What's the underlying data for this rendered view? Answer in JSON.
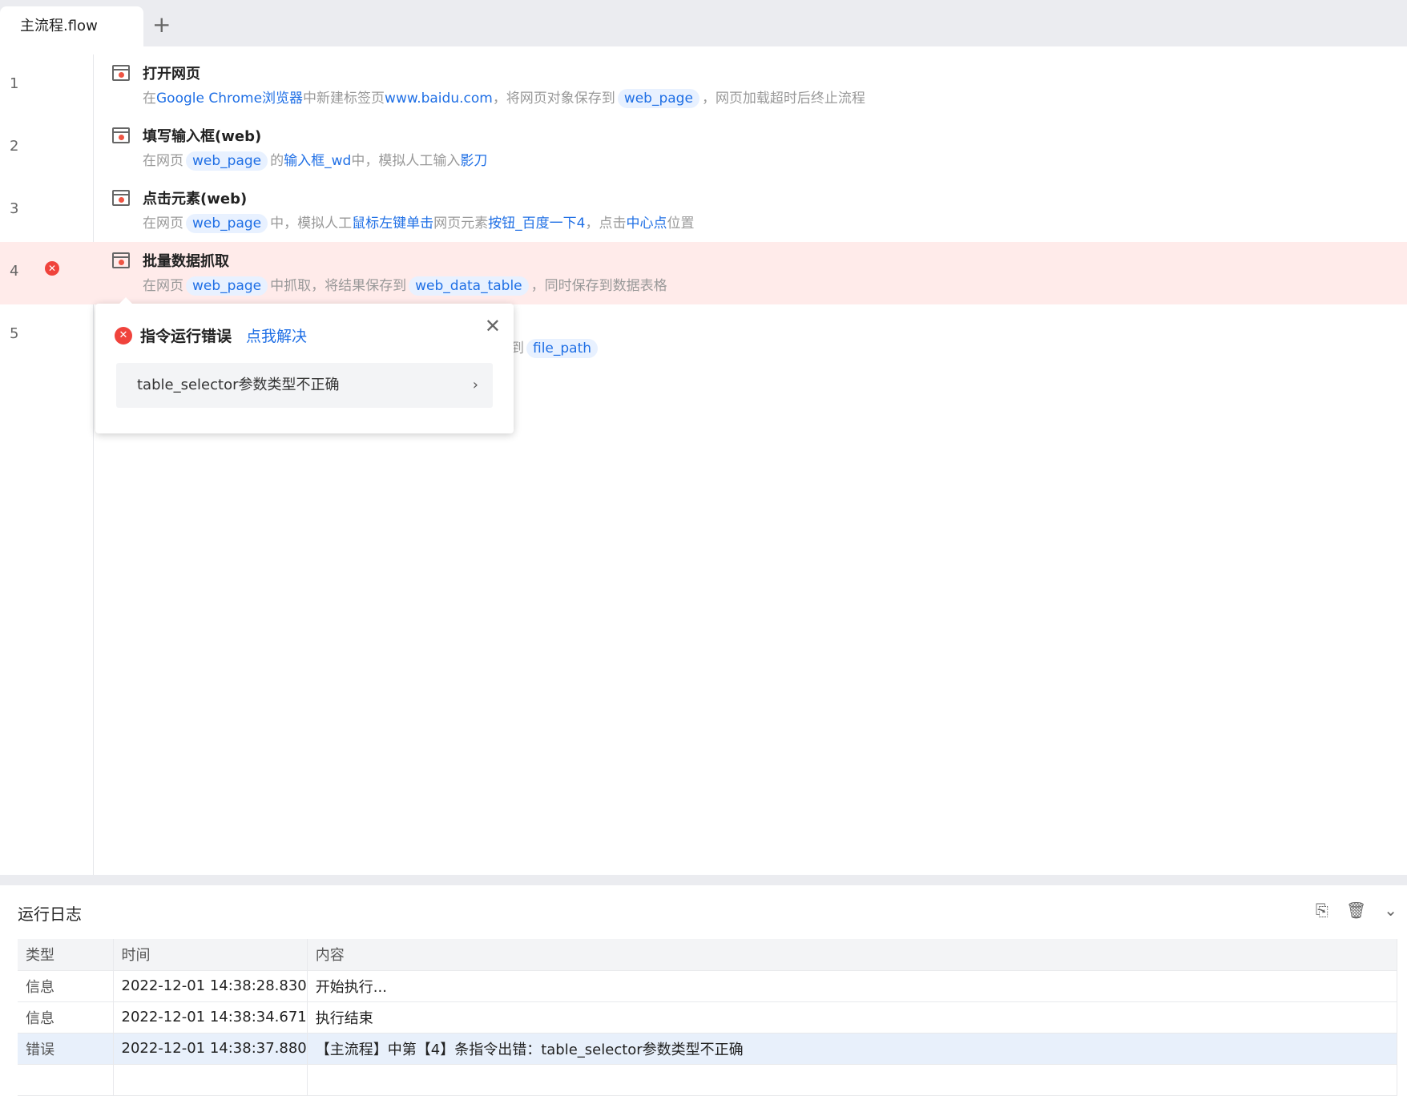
{
  "tabs": {
    "active": "主流程.flow",
    "add": "+"
  },
  "rows": [
    {
      "num": "1",
      "title": "打开网页",
      "desc": [
        [
          "t",
          "在"
        ],
        [
          "h",
          "Google Chrome浏览器"
        ],
        [
          "t",
          "中新建标签页"
        ],
        [
          "h",
          "www.baidu.com"
        ],
        [
          "t",
          "，将网页对象保存到"
        ],
        [
          "v",
          "web_page"
        ],
        [
          "t",
          "，网页加载超时后终止流程"
        ]
      ]
    },
    {
      "num": "2",
      "title": "填写输入框(web)",
      "desc": [
        [
          "t",
          "在网页"
        ],
        [
          "v",
          "web_page"
        ],
        [
          "t",
          "的"
        ],
        [
          "h",
          "输入框_wd"
        ],
        [
          "t",
          "中，模拟人工输入"
        ],
        [
          "h",
          "影刀"
        ]
      ]
    },
    {
      "num": "3",
      "title": "点击元素(web)",
      "desc": [
        [
          "t",
          "在网页"
        ],
        [
          "v",
          "web_page"
        ],
        [
          "t",
          "中，模拟人工"
        ],
        [
          "h",
          "鼠标左键单击"
        ],
        [
          "t",
          "网页元素"
        ],
        [
          "h",
          "按钮_百度一下4"
        ],
        [
          "t",
          "，点击"
        ],
        [
          "h",
          "中心点"
        ],
        [
          "t",
          "位置"
        ]
      ]
    },
    {
      "num": "4",
      "title": "批量数据抓取",
      "desc": [
        [
          "t",
          "在网页"
        ],
        [
          "v",
          "web_page"
        ],
        [
          "t",
          "中抓取，将结果保存到"
        ],
        [
          "v",
          "web_data_table"
        ],
        [
          "t",
          "，同时保存到数据表格"
        ]
      ]
    },
    {
      "num": "5",
      "title": "",
      "desc": [
        [
          "t",
          "到"
        ],
        [
          "v",
          "file_path"
        ]
      ]
    }
  ],
  "popup": {
    "title": "指令运行错误",
    "fix": "点我解决",
    "item": "table_selector参数类型不正确",
    "close": "✕",
    "chevron": "›"
  },
  "log": {
    "title": "运行日志",
    "headers": [
      "类型",
      "时间",
      "内容"
    ],
    "rows": [
      [
        "信息",
        "2022-12-01 14:38:28.830",
        "开始执行..."
      ],
      [
        "信息",
        "2022-12-01 14:38:34.671",
        "执行结束"
      ],
      [
        "错误",
        "2022-12-01 14:38:37.880",
        "【主流程】中第【4】条指令出错：table_selector参数类型不正确"
      ]
    ]
  },
  "colors": {
    "accent": "#1f6fe5",
    "error": "#f0433c",
    "error_row": "#ffebea"
  }
}
